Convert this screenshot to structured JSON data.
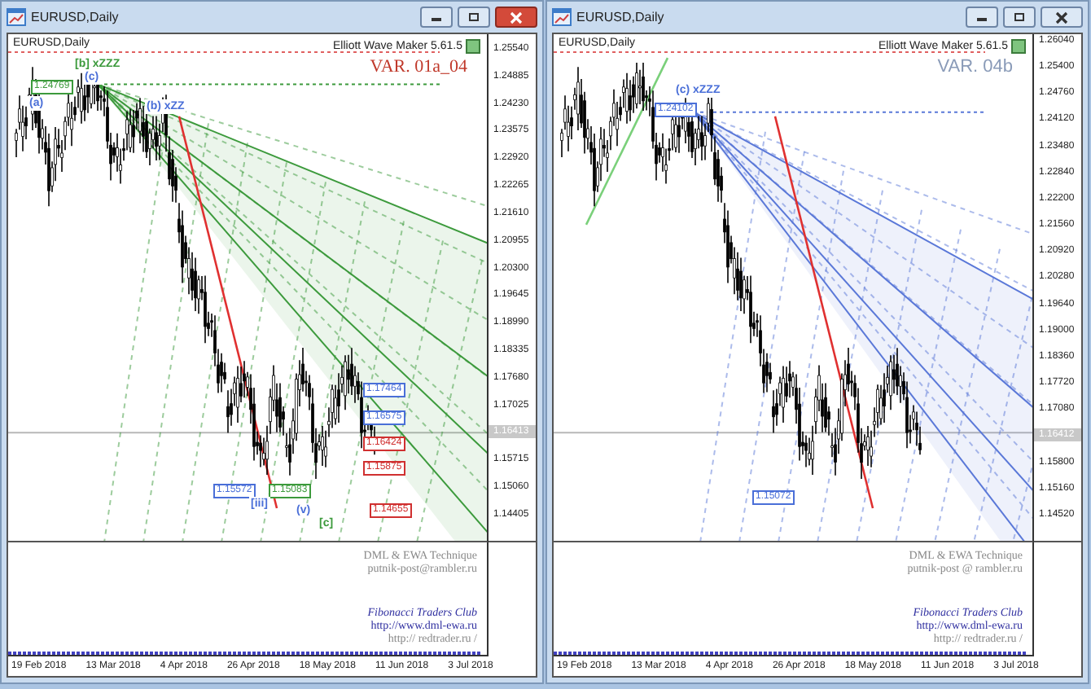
{
  "windows": [
    {
      "title": "EURUSD,Daily",
      "symbol": "EURUSD,Daily",
      "indicator": "Elliott Wave Maker 5.61.5",
      "variant": {
        "text": "VAR. 01a_04",
        "color": "#c0392b"
      },
      "color": "#3c9a3c",
      "price_axis": [
        {
          "label": "1.25540",
          "kind": "tick"
        },
        {
          "label": "1.24885",
          "kind": "tick"
        },
        {
          "label": "1.24230",
          "kind": "tick"
        },
        {
          "label": "1.23575",
          "kind": "tick"
        },
        {
          "label": "1.22920",
          "kind": "tick"
        },
        {
          "label": "1.22265",
          "kind": "tick"
        },
        {
          "label": "1.21610",
          "kind": "tick"
        },
        {
          "label": "1.20955",
          "kind": "tick"
        },
        {
          "label": "1.20300",
          "kind": "tick"
        },
        {
          "label": "1.19645",
          "kind": "tick"
        },
        {
          "label": "1.18990",
          "kind": "tick"
        },
        {
          "label": "1.18335",
          "kind": "tick"
        },
        {
          "label": "1.17680",
          "kind": "tick"
        },
        {
          "label": "1.17025",
          "kind": "tick"
        },
        {
          "label": "1.16413",
          "kind": "current"
        },
        {
          "label": "1.15715",
          "kind": "tick"
        },
        {
          "label": "1.15060",
          "kind": "tick"
        },
        {
          "label": "1.14405",
          "kind": "tick"
        }
      ],
      "labels": [
        {
          "text": "[b] xZZZ",
          "kind": "wave",
          "color": "#3c9a3c"
        },
        {
          "text": "1.24769",
          "kind": "tag",
          "color": "#3c9a3c"
        },
        {
          "text": "(c)",
          "kind": "wave",
          "color": "#4a6fd8"
        },
        {
          "text": "(a)",
          "kind": "wave",
          "color": "#4a6fd8"
        },
        {
          "text": "(b) xZZ",
          "kind": "wave",
          "color": "#4a6fd8"
        },
        {
          "text": "1.17464",
          "kind": "tag",
          "color": "#4a6fd8"
        },
        {
          "text": "1.16575",
          "kind": "tag",
          "color": "#4a6fd8"
        },
        {
          "text": "1.16424",
          "kind": "tag",
          "color": "#d03030"
        },
        {
          "text": "1.15875",
          "kind": "tag",
          "color": "#d03030"
        },
        {
          "text": "1.14655",
          "kind": "tag",
          "color": "#d03030"
        },
        {
          "text": "1.15572",
          "kind": "tag",
          "color": "#4a6fd8"
        },
        {
          "text": "1.15083",
          "kind": "tag",
          "color": "#3c9a3c"
        },
        {
          "text": "[iii]",
          "kind": "wave",
          "color": "#4a6fd8"
        },
        {
          "text": "(v)",
          "kind": "wave",
          "color": "#4a6fd8"
        },
        {
          "text": "[c]",
          "kind": "wave",
          "color": "#3c9a3c"
        }
      ],
      "footer": {
        "technique": "DML & EWA Technique",
        "email": "putnik-post@rambler.ru",
        "club": "Fibonacci Traders Club",
        "site": "http://www.dml-ewa.ru",
        "site_2": "http:// redtrader.ru /"
      },
      "dates": [
        "19 Feb 2018",
        "13 Mar 2018",
        "4 Apr 2018",
        "26 Apr 2018",
        "18 May 2018",
        "11 Jun 2018",
        "3 Jul 2018"
      ]
    },
    {
      "title": "EURUSD,Daily",
      "symbol": "EURUSD,Daily",
      "indicator": "Elliott Wave Maker 5.61.5",
      "variant": {
        "text": "VAR. 04b",
        "color": "#8a9bb8"
      },
      "color": "#5a78d8",
      "price_axis": [
        {
          "label": "1.26040",
          "kind": "tick"
        },
        {
          "label": "1.25400",
          "kind": "tick"
        },
        {
          "label": "1.24760",
          "kind": "tick"
        },
        {
          "label": "1.24120",
          "kind": "tick"
        },
        {
          "label": "1.23480",
          "kind": "tick"
        },
        {
          "label": "1.22840",
          "kind": "tick"
        },
        {
          "label": "1.22200",
          "kind": "tick"
        },
        {
          "label": "1.21560",
          "kind": "tick"
        },
        {
          "label": "1.20920",
          "kind": "tick"
        },
        {
          "label": "1.20280",
          "kind": "tick"
        },
        {
          "label": "1.19640",
          "kind": "tick"
        },
        {
          "label": "1.19000",
          "kind": "tick"
        },
        {
          "label": "1.18360",
          "kind": "tick"
        },
        {
          "label": "1.17720",
          "kind": "tick"
        },
        {
          "label": "1.17080",
          "kind": "tick"
        },
        {
          "label": "1.16412",
          "kind": "current"
        },
        {
          "label": "1.15800",
          "kind": "tick"
        },
        {
          "label": "1.15160",
          "kind": "tick"
        },
        {
          "label": "1.14520",
          "kind": "tick"
        }
      ],
      "labels": [
        {
          "text": "(c) xZZZ",
          "kind": "wave",
          "color": "#4a6fd8"
        },
        {
          "text": "1.24102",
          "kind": "tag",
          "color": "#4a6fd8"
        },
        {
          "text": "1.15072",
          "kind": "tag",
          "color": "#4a6fd8"
        }
      ],
      "footer": {
        "technique": "DML & EWA Technique",
        "email": "putnik-post @ rambler.ru",
        "club": "Fibonacci Traders Club",
        "site": "http://www.dml-ewa.ru",
        "site_2": "http:// redtrader.ru /"
      },
      "dates": [
        "19 Feb 2018",
        "13 Mar 2018",
        "4 Apr 2018",
        "26 Apr 2018",
        "18 May 2018",
        "11 Jun 2018",
        "3 Jul 2018"
      ]
    }
  ]
}
